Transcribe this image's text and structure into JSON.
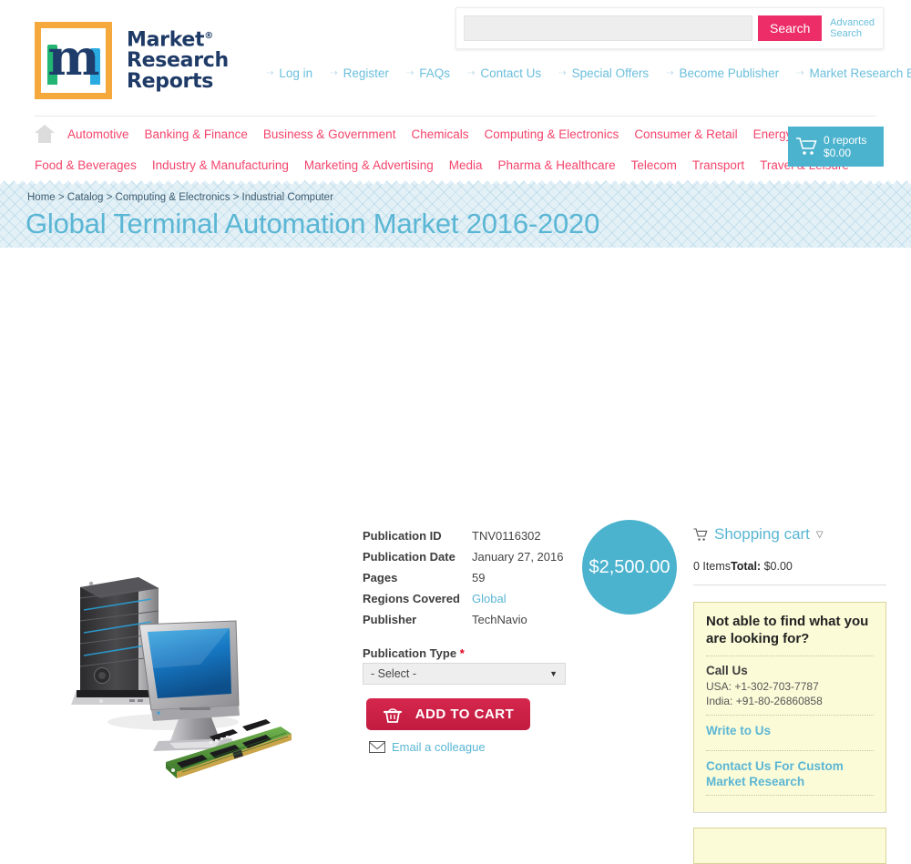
{
  "brand": {
    "logo_line1": "Market",
    "logo_line2": "Research",
    "logo_line3": "Reports",
    "logo_reg": "®",
    "logo_letter": "m",
    "accent_pink": "#f4456c",
    "accent_blue": "#5ab6d4",
    "accent_orange": "#f5a83c",
    "search_btn_color": "#ec2d68"
  },
  "search": {
    "value": "",
    "placeholder": "",
    "button_label": "Search",
    "advanced_label": "Advanced Search"
  },
  "top_links": [
    {
      "label": "Log in"
    },
    {
      "label": "Register"
    },
    {
      "label": "FAQs"
    },
    {
      "label": "Contact Us"
    },
    {
      "label": "Special Offers"
    },
    {
      "label": "Become Publisher"
    },
    {
      "label": "Market Research Blog"
    }
  ],
  "categories_row1": [
    {
      "label": "Automotive"
    },
    {
      "label": "Banking & Finance"
    },
    {
      "label": "Business & Government"
    },
    {
      "label": "Chemicals"
    },
    {
      "label": "Computing & Electronics"
    },
    {
      "label": "Consumer & Retail"
    },
    {
      "label": "Energy & Utilities"
    }
  ],
  "categories_row2": [
    {
      "label": "Food & Beverages"
    },
    {
      "label": "Industry & Manufacturing"
    },
    {
      "label": "Marketing & Advertising"
    },
    {
      "label": "Media"
    },
    {
      "label": "Pharma & Healthcare"
    },
    {
      "label": "Telecom"
    },
    {
      "label": "Transport"
    },
    {
      "label": "Travel & Leisure"
    }
  ],
  "header_cart": {
    "reports": "0 reports",
    "total": "$0.00"
  },
  "breadcrumb": {
    "items": [
      "Home",
      "Catalog",
      "Computing & Electronics",
      "Industrial Computer"
    ],
    "text": "Home > Catalog > Computing & Electronics > Industrial Computer"
  },
  "page": {
    "title": "Global Terminal Automation Market 2016-2020"
  },
  "details": [
    {
      "label": "Publication ID",
      "value": "TNV0116302",
      "is_link": false
    },
    {
      "label": "Publication Date",
      "value": "January 27, 2016",
      "is_link": false
    },
    {
      "label": "Pages",
      "value": "59",
      "is_link": false
    },
    {
      "label": "Regions Covered",
      "value": "Global",
      "is_link": true
    },
    {
      "label": "Publisher",
      "value": "TechNavio",
      "is_link": false
    }
  ],
  "price": {
    "badge": "$2,500.00"
  },
  "purchase": {
    "pubtype_label": "Publication Type",
    "pubtype_required": "*",
    "pubtype_selected": "- Select -",
    "pubtype_options": [
      "- Select -"
    ],
    "add_to_cart_label": "ADD TO CART",
    "email_colleague_label": "Email a colleague"
  },
  "sidebar": {
    "cart_title": "Shopping cart",
    "cart_items": "0 Items",
    "cart_total_label": "Total:",
    "cart_total_value": "$0.00",
    "help": {
      "heading": "Not able to find what you are looking for?",
      "call_us_label": "Call Us",
      "phone_usa": "USA: +1-302-703-7787",
      "phone_india": "India: +91-80-26860858",
      "write_to_us": "Write to Us",
      "custom_research": "Contact Us For Custom Market Research"
    }
  }
}
